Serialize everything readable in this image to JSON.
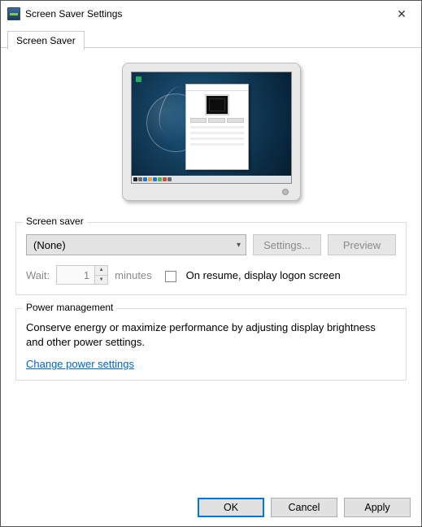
{
  "window": {
    "title": "Screen Saver Settings"
  },
  "tabs": {
    "screensaver": "Screen Saver"
  },
  "group_screensaver": {
    "legend": "Screen saver",
    "combo_selected": "(None)",
    "settings_btn": "Settings...",
    "preview_btn": "Preview",
    "wait_label": "Wait:",
    "wait_value": "1",
    "minutes_label": "minutes",
    "resume_label": "On resume, display logon screen"
  },
  "group_power": {
    "legend": "Power management",
    "text": "Conserve energy or maximize performance by adjusting display brightness and other power settings.",
    "link": "Change power settings"
  },
  "footer": {
    "ok": "OK",
    "cancel": "Cancel",
    "apply": "Apply"
  }
}
